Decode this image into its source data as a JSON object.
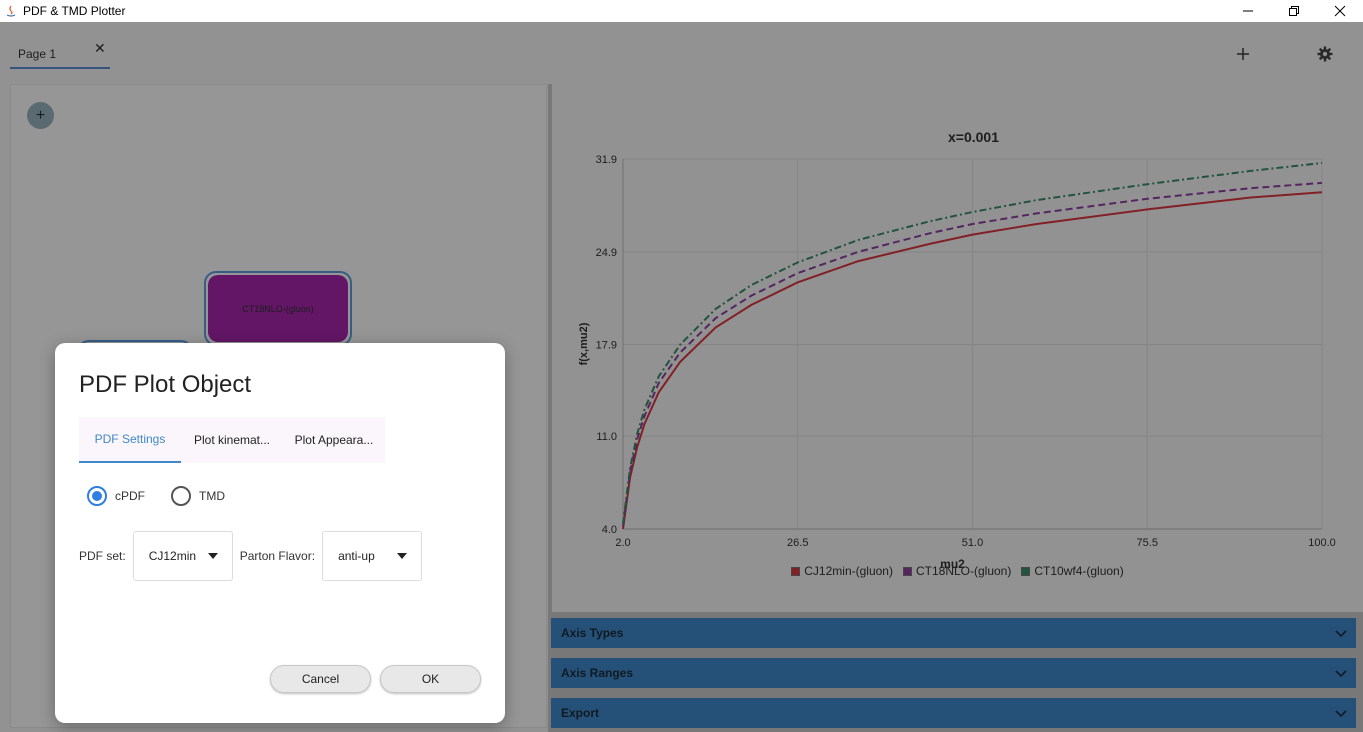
{
  "window": {
    "title": "PDF & TMD Plotter"
  },
  "tabs": [
    {
      "label": "Page 1"
    }
  ],
  "canvas": {
    "node_label": "CT18NLO-(gluon)"
  },
  "chart_data": {
    "type": "line",
    "title": "x=0.001",
    "xlabel": "mu2",
    "ylabel": "f(x,mu2)",
    "xlim": [
      2.0,
      100.0
    ],
    "ylim": [
      4.0,
      31.9
    ],
    "xticks": [
      "2.0",
      "26.5",
      "51.0",
      "75.5",
      "100.0"
    ],
    "yticks": [
      "4.0",
      "11.0",
      "17.9",
      "24.9",
      "31.9"
    ],
    "grid": true,
    "legend_position": "bottom",
    "x": [
      2,
      3,
      4,
      5,
      7,
      10,
      15,
      20,
      26.5,
      35,
      45,
      51,
      60,
      75.5,
      90,
      100
    ],
    "series": [
      {
        "name": "CJ12min-(gluon)",
        "color": "#d9363e",
        "style": "solid",
        "values": [
          4.0,
          7.9,
          10.2,
          11.9,
          14.3,
          16.6,
          19.2,
          20.9,
          22.6,
          24.2,
          25.5,
          26.2,
          27.0,
          28.1,
          29.0,
          29.4
        ]
      },
      {
        "name": "CT18NLO-(gluon)",
        "color": "#8e3fa0",
        "style": "dashed",
        "values": [
          4.2,
          8.3,
          10.8,
          12.5,
          15.0,
          17.3,
          19.9,
          21.6,
          23.3,
          24.9,
          26.3,
          27.0,
          27.8,
          28.9,
          29.7,
          30.1
        ]
      },
      {
        "name": "CT10wf4-(gluon)",
        "color": "#3a8a6a",
        "style": "dashdot",
        "values": [
          4.4,
          8.6,
          11.2,
          13.0,
          15.5,
          17.9,
          20.6,
          22.4,
          24.1,
          25.8,
          27.2,
          27.9,
          28.8,
          30.0,
          31.0,
          31.6
        ]
      }
    ]
  },
  "accordions": [
    {
      "label": "Axis Types"
    },
    {
      "label": "Axis Ranges"
    },
    {
      "label": "Export"
    }
  ],
  "dialog": {
    "title": "PDF Plot Object",
    "tabs": [
      {
        "label": "PDF Settings"
      },
      {
        "label": "Plot kinemat..."
      },
      {
        "label": "Plot Appeara..."
      }
    ],
    "radio_cpdf": "cPDF",
    "radio_tmd": "TMD",
    "pdf_set_label": "PDF set:",
    "pdf_set_value": "CJ12min",
    "parton_label": "Parton Flavor:",
    "parton_value": "anti-up",
    "cancel_label": "Cancel",
    "ok_label": "OK"
  }
}
